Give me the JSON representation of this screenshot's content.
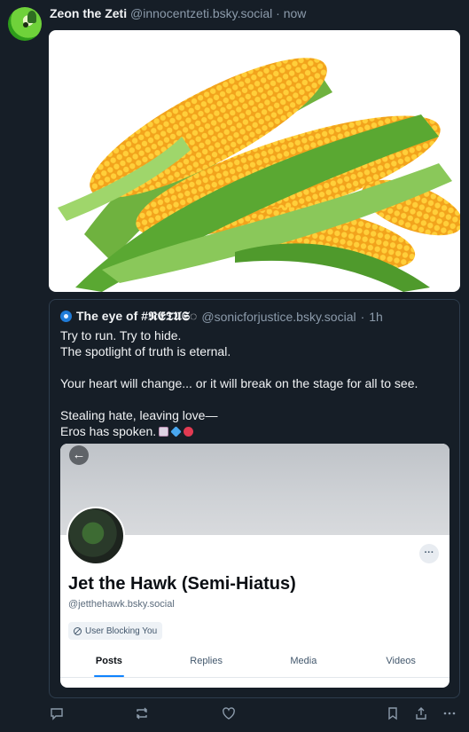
{
  "post": {
    "author_name": "Zeon the Zeti",
    "author_handle": "@innocentzeti.bsky.social",
    "separator": "·",
    "time": "now",
    "image_icon": "corn-image"
  },
  "quote": {
    "author_name": "The eye of #𝕹𝕰𝕿𝖀𝕾◌",
    "author_handle": "@sonicforjustice.bsky.social",
    "separator": "·",
    "time": "1h",
    "lines": [
      "Try to run. Try to hide.",
      "The spotlight of truth is eternal.",
      "",
      "Your heart will change... or it will break on the stage for all to see.",
      "",
      "Stealing hate, leaving love—",
      "Eros has spoken."
    ],
    "emojis": [
      "tarot-card-emoji",
      "gem-emoji",
      "heart-emoji"
    ]
  },
  "embed": {
    "back_icon": "←",
    "more_icon": "···",
    "display_name": "Jet the Hawk (Semi-Hiatus)",
    "handle": "@jetthehawk.bsky.social",
    "badge": "User Blocking You",
    "tabs": [
      "Posts",
      "Replies",
      "Media",
      "Videos"
    ],
    "active_tab": "Posts",
    "accent": "#1083fe"
  },
  "actions": [
    "reply-icon",
    "repost-icon",
    "like-icon",
    "bookmark-icon",
    "share-icon",
    "more-icon"
  ]
}
